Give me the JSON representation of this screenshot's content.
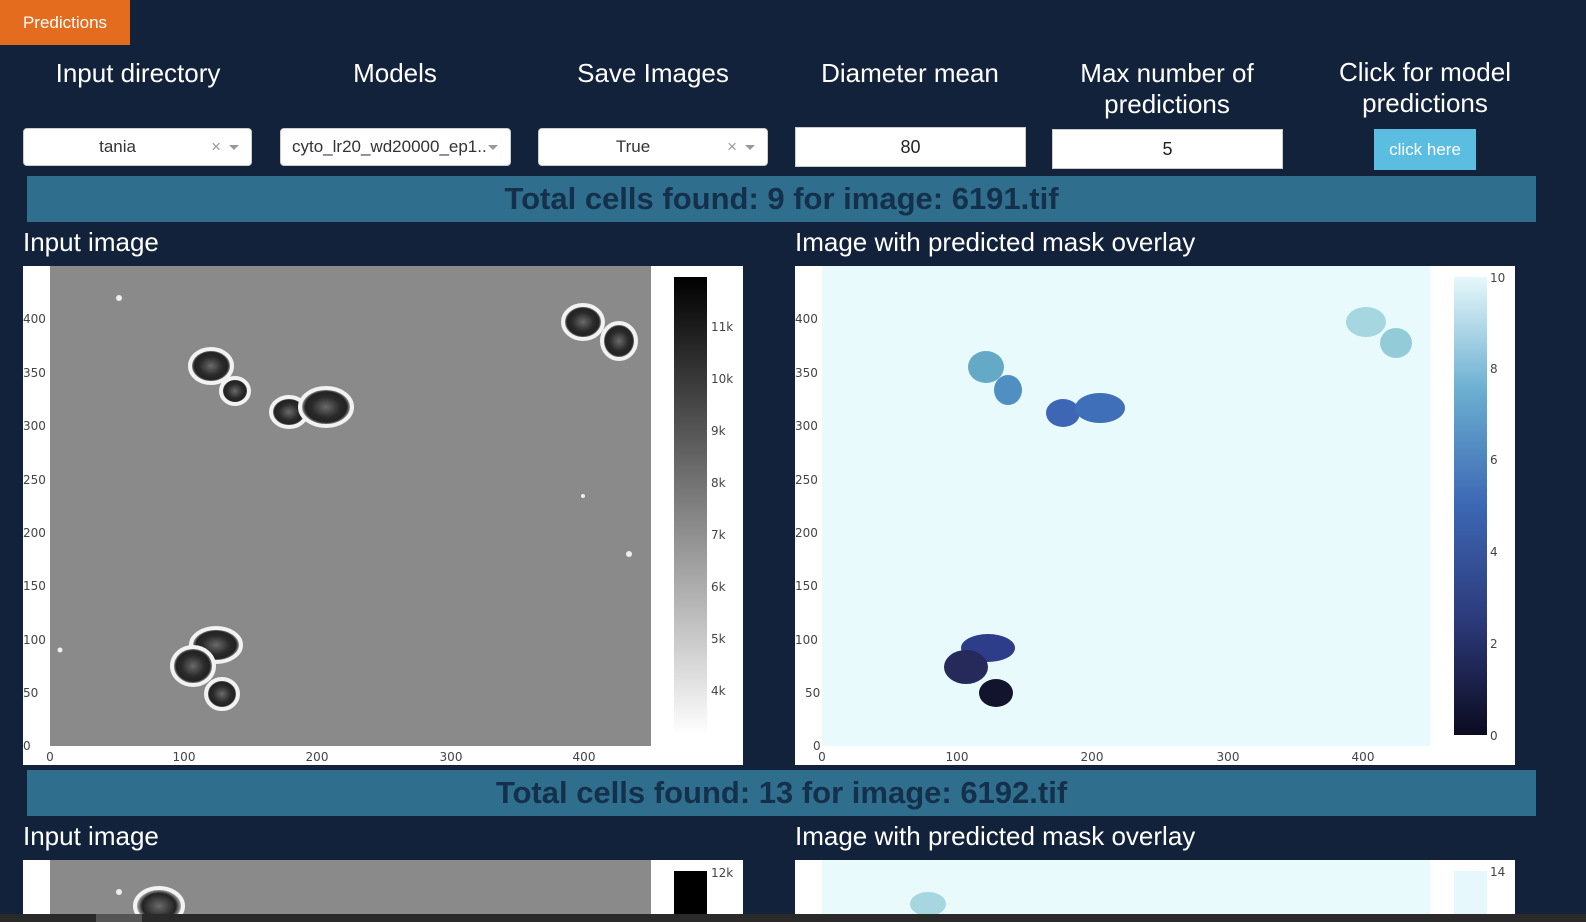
{
  "tab": {
    "label": "Predictions"
  },
  "controls": {
    "input_directory": {
      "label": "Input directory",
      "value": "tania"
    },
    "models": {
      "label": "Models",
      "value": "cyto_lr20_wd20000_ep1..."
    },
    "save_images": {
      "label": "Save Images",
      "value": "True"
    },
    "diameter_mean": {
      "label": "Diameter mean",
      "value": "80"
    },
    "max_predictions": {
      "label": "Max number of predictions",
      "value": "5"
    },
    "model_predictions": {
      "label": "Click for model predictions",
      "button": "click here"
    }
  },
  "results": [
    {
      "banner": "Total cells found: 9 for image: 6191.tif",
      "input_title": "Input image",
      "mask_title": "Image with predicted mask overlay",
      "input_plot": {
        "x_ticks": [
          "0",
          "100",
          "200",
          "300",
          "400"
        ],
        "y_ticks": [
          "0",
          "50",
          "100",
          "150",
          "200",
          "250",
          "300",
          "350",
          "400"
        ],
        "colorbar_ticks": [
          "4k",
          "5k",
          "6k",
          "7k",
          "8k",
          "9k",
          "10k",
          "11k"
        ]
      },
      "mask_plot": {
        "x_ticks": [
          "0",
          "100",
          "200",
          "300",
          "400"
        ],
        "y_ticks": [
          "0",
          "50",
          "100",
          "150",
          "200",
          "250",
          "300",
          "350",
          "400"
        ],
        "colorbar_ticks": [
          "0",
          "2",
          "4",
          "6",
          "8",
          "10"
        ]
      }
    },
    {
      "banner": "Total cells found: 13 for image: 6192.tif",
      "input_title": "Input image",
      "mask_title": "Image with predicted mask overlay",
      "input_plot": {
        "colorbar_ticks": [
          "12k"
        ]
      },
      "mask_plot": {
        "colorbar_ticks": [
          "14"
        ]
      }
    }
  ],
  "colors": {
    "background": "#11223a",
    "tab": "#e36c1e",
    "banner": "#2f6e8c",
    "banner_text": "#14304a",
    "button": "#5bbde0"
  }
}
